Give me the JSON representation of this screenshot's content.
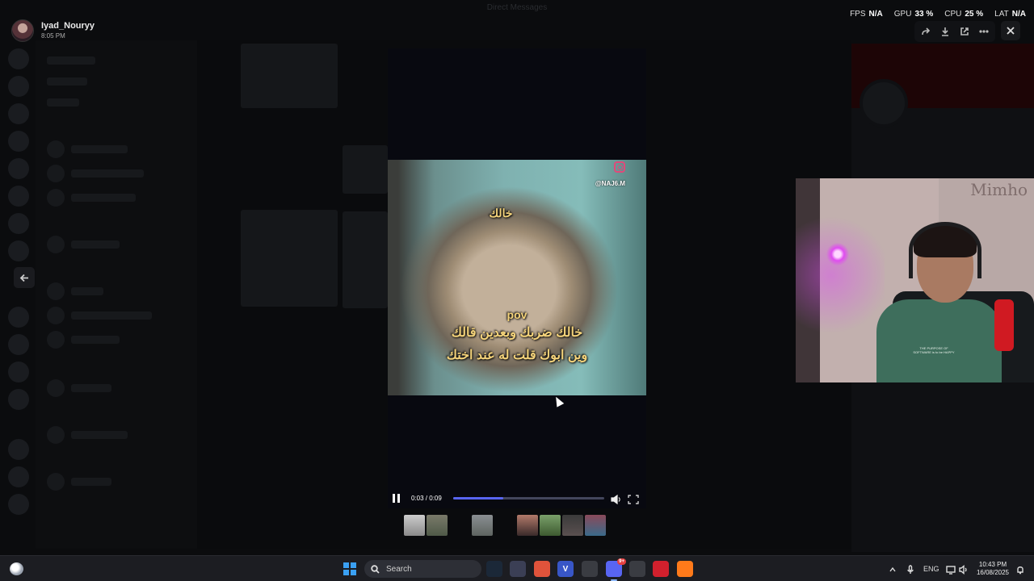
{
  "background_app": {
    "window_title": "Direct Messages"
  },
  "uploader": {
    "name": "Iyad_Nouryy",
    "time": "8:05 PM"
  },
  "stats": [
    {
      "label": "FPS",
      "value": "N/A"
    },
    {
      "label": "GPU",
      "value": "33 %"
    },
    {
      "label": "CPU",
      "value": "25 %"
    },
    {
      "label": "LAT",
      "value": "N/A"
    }
  ],
  "viewer_actions": [
    "forward-icon",
    "download-icon",
    "open-external-icon",
    "more-icon"
  ],
  "video": {
    "caption_top": "خالك",
    "caption_pov": "pov",
    "caption_line1": "خالك ضربك وبعدين قالك",
    "caption_line2": "وين ابوك قلت له عند اختك",
    "instagram_handle": "@NAJ6.M",
    "timecode": "0:03 / 0:09",
    "progress_fraction": 0.33
  },
  "webcam": {
    "watermark": "Mimho",
    "shirt_text": "THE PURPOSE OF SOFTWARE is to be HAPPY"
  },
  "taskbar": {
    "search_placeholder": "Search",
    "apps": [
      {
        "name": "steam-icon",
        "label": "",
        "color": "#1b2838"
      },
      {
        "name": "capture-icon",
        "label": "",
        "color": "#3b3f55"
      },
      {
        "name": "chrome-icon",
        "label": "",
        "color": "#e0533b"
      },
      {
        "name": "vpn-icon",
        "label": "V",
        "color": "#3856c7"
      },
      {
        "name": "chatgpt-icon",
        "label": "",
        "color": "#3a3c42"
      },
      {
        "name": "discord-icon",
        "label": "",
        "color": "#5865f2",
        "badge": "9+"
      },
      {
        "name": "settings-app-icon",
        "label": "",
        "color": "#3a3c42"
      },
      {
        "name": "opera-icon",
        "label": "",
        "color": "#d1202d"
      },
      {
        "name": "firefox-icon",
        "label": "",
        "color": "#ff7a1a"
      }
    ],
    "language": "ENG",
    "clock_time": "10:43 PM",
    "clock_date": "16/08/2025"
  },
  "colors": {
    "accent": "#5865f2",
    "caption": "#f3d27a"
  }
}
